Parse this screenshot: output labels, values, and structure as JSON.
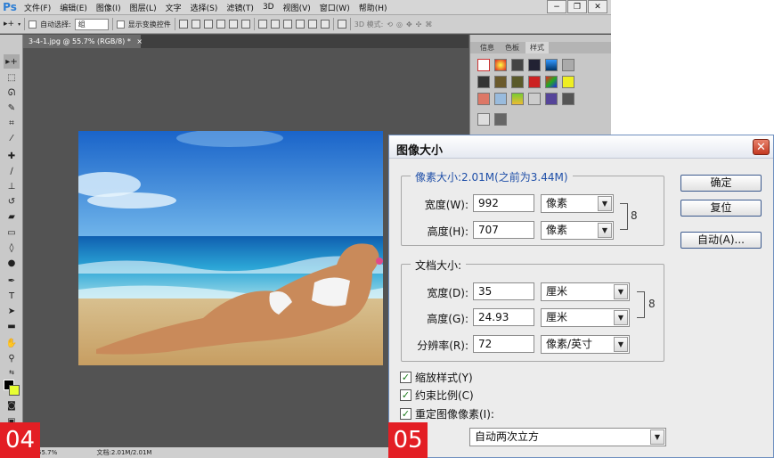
{
  "app": {
    "logo": "Ps",
    "menu": [
      "文件(F)",
      "编辑(E)",
      "图像(I)",
      "图层(L)",
      "文字",
      "选择(S)",
      "滤镜(T)",
      "3D",
      "视图(V)",
      "窗口(W)",
      "帮助(H)"
    ],
    "window_buttons": [
      "−",
      "❐",
      "✕"
    ]
  },
  "options_bar": {
    "auto_select_label": "自动选择:",
    "auto_select_value": "组",
    "show_transform_label": "显示变换控件",
    "mode_3d_label": "3D 模式:"
  },
  "document": {
    "tab_label": "3-4-1.jpg @ 55.7% (RGB/8) *",
    "tab_close": "×",
    "zoom": "55.7%",
    "doc_size": "文档:2.01M/2.01M"
  },
  "panel": {
    "tabs": [
      "信息",
      "色板",
      "样式"
    ],
    "active_tab": "样式"
  },
  "colors": {
    "foreground": "#000000",
    "background": "#e8ff34",
    "step_badge": "#e31e24"
  },
  "steps": {
    "left": "04",
    "right": "05"
  },
  "dialog": {
    "title": "图像大小",
    "close_label": "✕",
    "pixel_dimensions": {
      "title": "像素大小:2.01M(之前为3.44M)",
      "width_label": "宽度(W):",
      "width_value": "992",
      "width_unit": "像素",
      "height_label": "高度(H):",
      "height_value": "707",
      "height_unit": "像素"
    },
    "document_size": {
      "title": "文档大小:",
      "width_label": "宽度(D):",
      "width_value": "35",
      "width_unit": "厘米",
      "height_label": "高度(G):",
      "height_value": "24.93",
      "height_unit": "厘米",
      "resolution_label": "分辨率(R):",
      "resolution_value": "72",
      "resolution_unit": "像素/英寸"
    },
    "checkboxes": {
      "scale_styles": "缩放样式(Y)",
      "constrain_proportions": "约束比例(C)",
      "resample": "重定图像像素(I):"
    },
    "resample_method": "自动两次立方",
    "buttons": {
      "ok": "确定",
      "reset": "复位",
      "auto": "自动(A)..."
    }
  }
}
